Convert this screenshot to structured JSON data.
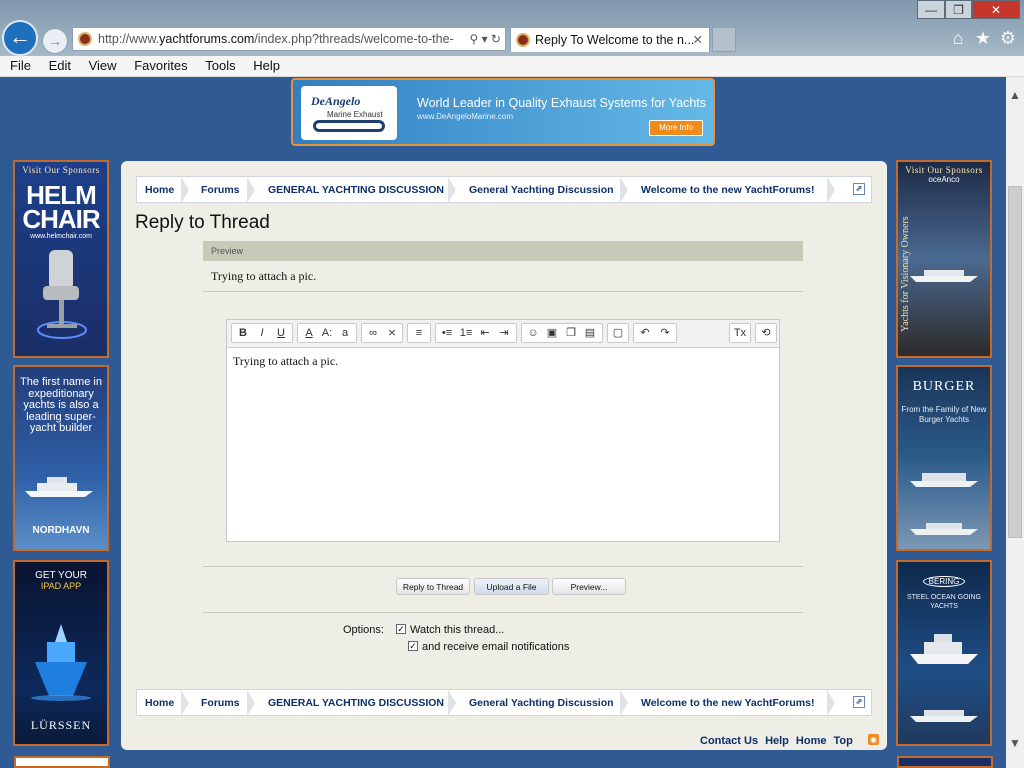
{
  "browser": {
    "address_prefix": "http://www.",
    "address_host": "yachtforums.com",
    "address_path": "/index.php?threads/welcome-to-the-",
    "address_icons": "⚲ ▾ ↻",
    "tab_title": "Reply To Welcome to the n...",
    "tab_close": "✕",
    "back_glyph": "←",
    "forward_glyph": "→",
    "minimize_glyph": "—",
    "maximize_glyph": "❐",
    "close_glyph": "✕",
    "home_icon": "⌂",
    "favorites_icon": "★",
    "settings_icon": "⚙"
  },
  "menu": [
    "File",
    "Edit",
    "View",
    "Favorites",
    "Tools",
    "Help"
  ],
  "banner": {
    "brand": "DeAngelo",
    "brand_sub": "Marine Exhaust",
    "tagline": "World Leader in Quality Exhaust Systems for Yachts",
    "url": "www.DeAngeloMarine.com",
    "cta": "More Info"
  },
  "sponsors": {
    "header": "Visit Our Sponsors",
    "helm_title": "HELM CHAIR",
    "helm_url": "www.helmchair.com",
    "nordhavn_text": "The first name in expeditionary yachts is also a leading super-yacht builder",
    "nordhavn_brand": "NORDHAVN",
    "lurssen_t1": "GET YOUR",
    "lurssen_t2": "IPAD APP",
    "lurssen_brand": "LÜRSSEN",
    "oceanco_brand": "oceAnco",
    "oceanco_vertical": "Yachts for Visionary Owners",
    "burger_brand": "BURGER",
    "burger_text": "From the Family of New Burger Yachts",
    "bering_brand": "BERING",
    "bering_text": "STEEL OCEAN GOING YACHTS"
  },
  "breadcrumbs": [
    "Home",
    "Forums",
    "GENERAL YACHTING DISCUSSION",
    "General Yachting Discussion",
    "Welcome to the new YachtForums!"
  ],
  "jump_icon": "⇗",
  "page_title": "Reply to Thread",
  "preview": {
    "header": "Preview",
    "body": "Trying to attach a pic."
  },
  "editor": {
    "content": "Trying to attach a pic.",
    "toolbar": [
      "B",
      "I",
      "U",
      "A",
      "A:",
      "a",
      "∞",
      "⨯",
      "≡",
      "•≡",
      "1≡",
      "⇤",
      "⇥",
      "☺",
      "▣",
      "❐",
      "▤",
      "▢",
      "↶",
      "↷",
      "Tx",
      "⟲"
    ]
  },
  "buttons": {
    "reply": "Reply to Thread",
    "upload": "Upload a File",
    "preview": "Preview..."
  },
  "options": {
    "label": "Options:",
    "watch": "Watch this thread...",
    "email": "and receive email notifications",
    "watch_checked": true,
    "email_checked": true,
    "check_glyph": "✓"
  },
  "footer": {
    "links": [
      "Contact Us",
      "Help",
      "Home",
      "Top"
    ],
    "rss_icon": "◉"
  },
  "scroll": {
    "up": "▲",
    "down": "▼"
  },
  "colors": {
    "page_bg": "#2f5a94",
    "content_bg": "#eeede6",
    "link": "#0d2f6a",
    "accent_orange": "#e7903a"
  }
}
